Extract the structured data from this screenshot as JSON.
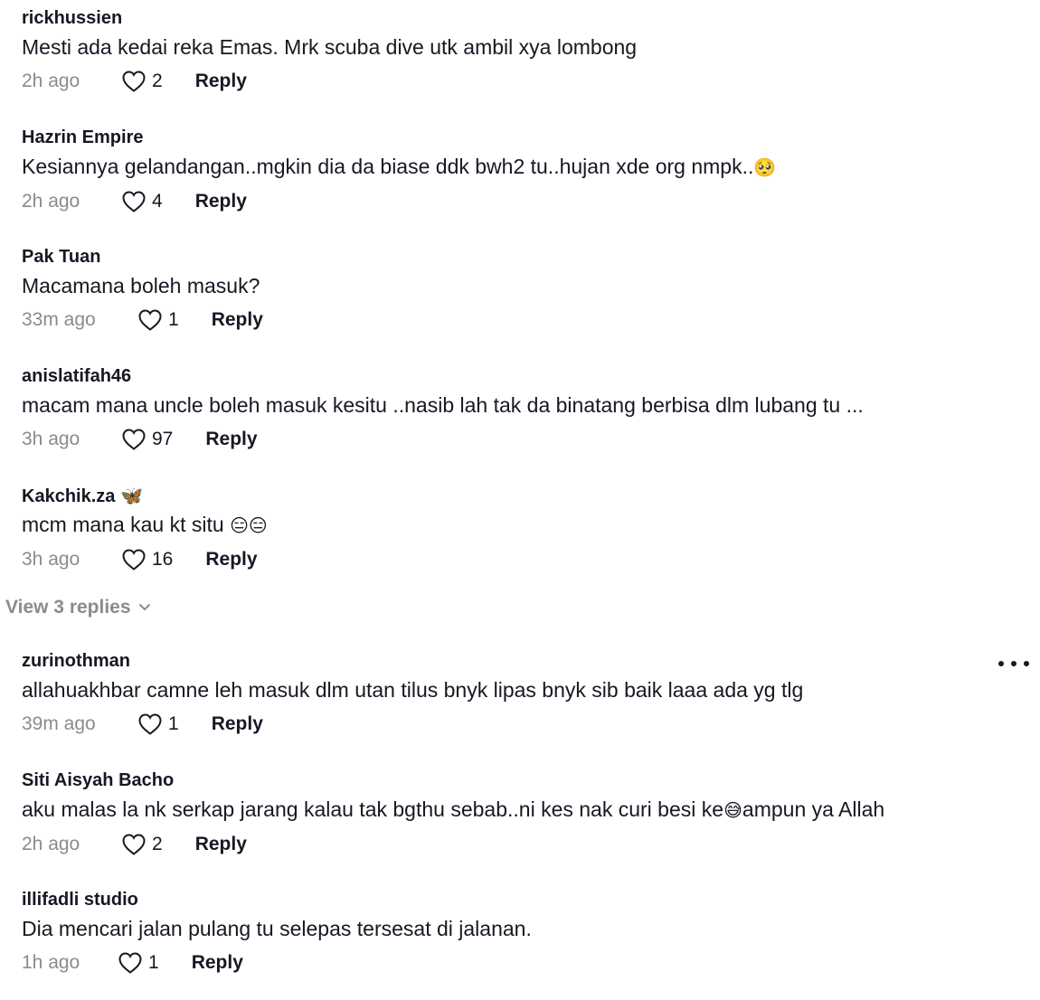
{
  "comments": [
    {
      "username": "rickhussien",
      "text": "Mesti ada kedai reka Emas. Mrk scuba dive utk ambil xya lombong",
      "time": "2h ago",
      "likes": "2",
      "reply": "Reply"
    },
    {
      "username": "Hazrin Empire",
      "text": "Kesiannya gelandangan..mgkin dia da biase ddk bwh2 tu..hujan xde org nmpk..",
      "emoji": "🥺",
      "time": "2h ago",
      "likes": "4",
      "reply": "Reply"
    },
    {
      "username": "Pak Tuan",
      "text": "Macamana boleh masuk?",
      "time": "33m ago",
      "likes": "1",
      "reply": "Reply"
    },
    {
      "username": "anislatifah46",
      "text": "macam mana uncle boleh masuk kesitu ..nasib lah tak da binatang berbisa dlm lubang tu ...",
      "time": "3h ago",
      "likes": "97",
      "reply": "Reply"
    },
    {
      "username": "Kakchik.za",
      "username_emoji": "🦋",
      "text": "mcm mana kau kt situ",
      "emoji": "😑😑",
      "time": "3h ago",
      "likes": "16",
      "reply": "Reply"
    },
    {
      "username": "zurinothman",
      "text": "allahuakhbar camne leh masuk dlm utan tilus bnyk lipas bnyk sib baik laaa ada yg tlg",
      "time": "39m ago",
      "likes": "1",
      "reply": "Reply"
    },
    {
      "username": "Siti Aisyah Bacho",
      "text_before": "aku malas la nk serkap jarang kalau tak bgthu sebab..ni kes nak curi besi ke",
      "emoji": "😅",
      "text_after": "ampun ya Allah",
      "time": "2h ago",
      "likes": "2",
      "reply": "Reply"
    },
    {
      "username": "illifadli studio",
      "text": "Dia mencari jalan pulang tu selepas tersesat di jalanan.",
      "time": "1h ago",
      "likes": "1",
      "reply": "Reply"
    }
  ],
  "view_replies": "View 3 replies",
  "icons": {
    "like": "heart-outline-icon",
    "more": "more-horizontal-icon",
    "chevron": "chevron-down-icon"
  }
}
